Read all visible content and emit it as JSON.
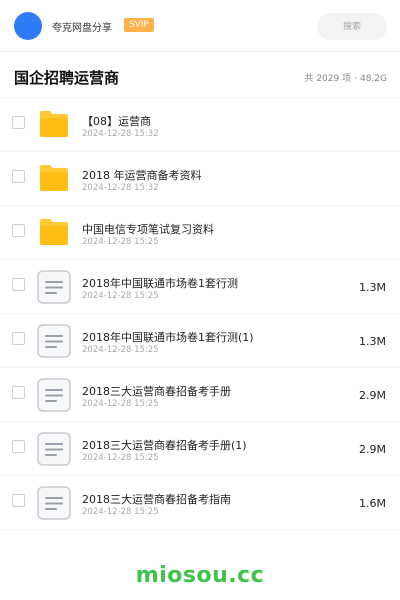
{
  "header": {
    "owner": "夸克网盘分享",
    "badge": "SVIP",
    "search_placeholder": "搜索"
  },
  "folder": {
    "title": "国企招聘运营商",
    "count": "共 2029 项",
    "separator": "·",
    "total_size": "48.2G"
  },
  "items": [
    {
      "type": "folder",
      "icon": "folder-icon",
      "name": "【08】运营商",
      "date": "2024-12-28 15:32",
      "size": ""
    },
    {
      "type": "folder",
      "icon": "folder-icon",
      "name": "2018 年运营商备考资料",
      "date": "2024-12-28 15:32",
      "size": ""
    },
    {
      "type": "folder",
      "icon": "folder-icon",
      "name": "中国电信专项笔试复习资料",
      "date": "2024-12-28 15:25",
      "size": ""
    },
    {
      "type": "file",
      "icon": "document-icon",
      "name": "2018年中国联通市场卷1套行测",
      "date": "2024-12-28 15:25",
      "size": "1.3M"
    },
    {
      "type": "file",
      "icon": "document-icon",
      "name": "2018年中国联通市场卷1套行测(1)",
      "date": "2024-12-28 15:25",
      "size": "1.3M"
    },
    {
      "type": "file",
      "icon": "document-icon",
      "name": "2018三大运营商春招备考手册",
      "date": "2024-12-28 15:25",
      "size": "2.9M"
    },
    {
      "type": "file",
      "icon": "document-icon",
      "name": "2018三大运营商春招备考手册(1)",
      "date": "2024-12-28 15:25",
      "size": "2.9M"
    },
    {
      "type": "file",
      "icon": "document-icon",
      "name": "2018三大运营商春招备考指南",
      "date": "2024-12-28 15:25",
      "size": "1.6M"
    }
  ],
  "footer": {
    "brand": "miosou.cc"
  },
  "colors": {
    "avatar": "#2f7df6",
    "badge": "#ffb14a",
    "folder": "#ffc933",
    "brand": "#3fc24a"
  }
}
